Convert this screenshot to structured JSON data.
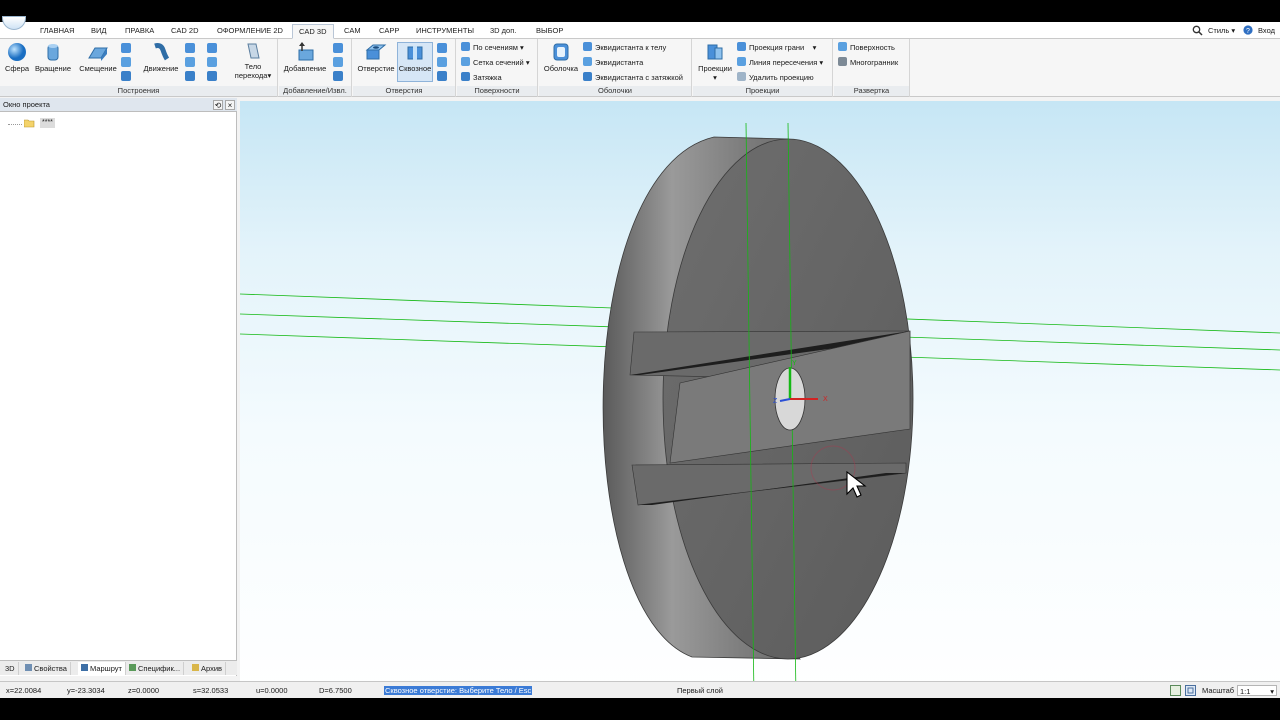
{
  "menu": {
    "tabs": [
      "ГЛАВНАЯ",
      "ВИД",
      "ПРАВКА",
      "CAD 2D",
      "ОФОРМЛЕНИЕ 2D",
      "CAD 3D",
      "CAM",
      "CAPP",
      "ИНСТРУМЕНТЫ",
      "3D доп.",
      "ВЫБОР"
    ],
    "active_tab": "CAD 3D",
    "style_label": "Стиль",
    "login_label": "Вход"
  },
  "ribbon": {
    "groups": {
      "build": "Построения",
      "add": "Добавление/Извл.",
      "holes": "Отверстия",
      "surfaces": "Поверхности",
      "shells": "Оболочки",
      "projections": "Проекции",
      "unfold": "Развертка"
    },
    "buttons": {
      "sphere": "Сфера",
      "rotation": "Вращение",
      "offset": "Смещение",
      "motion": "Движение",
      "transition_body_1": "Тело",
      "transition_body_2": "перехода",
      "addition": "Добавление",
      "hole": "Отверстие",
      "through": "Сквозное",
      "by_sections": "По сечениям",
      "section_grid": "Сетка сечений",
      "tightening": "Затяжка",
      "shell": "Оболочка",
      "equidistant_body": "Эквидистанта к телу",
      "equidistant": "Эквидистанта",
      "equidistant_tight": "Эквидистанта с затяжкой",
      "projections": "Проекции",
      "face_projection": "Проекция грани",
      "intersection_line": "Линия пересечения",
      "delete_projection": "Удалить проекцию",
      "surface": "Поверхность",
      "polyhedron": "Многогранник"
    }
  },
  "panel": {
    "title": "Окно проекта",
    "tree_item": "****",
    "tabs": [
      "3D",
      "Свойства",
      "Маршрут",
      "Специфик...",
      "Архив"
    ]
  },
  "viewport": {
    "axis_x": "X",
    "axis_y": "Y",
    "axis_z": "Z",
    "colors": {
      "body_face": "#6e6e6e",
      "body_side": "#8a8a8a",
      "grid_line": "#14b814",
      "sky_top": "#c6e6f5"
    }
  },
  "status": {
    "x": "x=22.0084",
    "y": "y=-23.3034",
    "z": "z=0.0000",
    "s": "s=32.0533",
    "u": "u=0.0000",
    "d": "D=6.7500",
    "hint": "Сквозное отверстие: Выберите Тело / Esc",
    "layer": "Первый слой",
    "scale_label": "Масштаб",
    "scale_value": "1:1"
  }
}
